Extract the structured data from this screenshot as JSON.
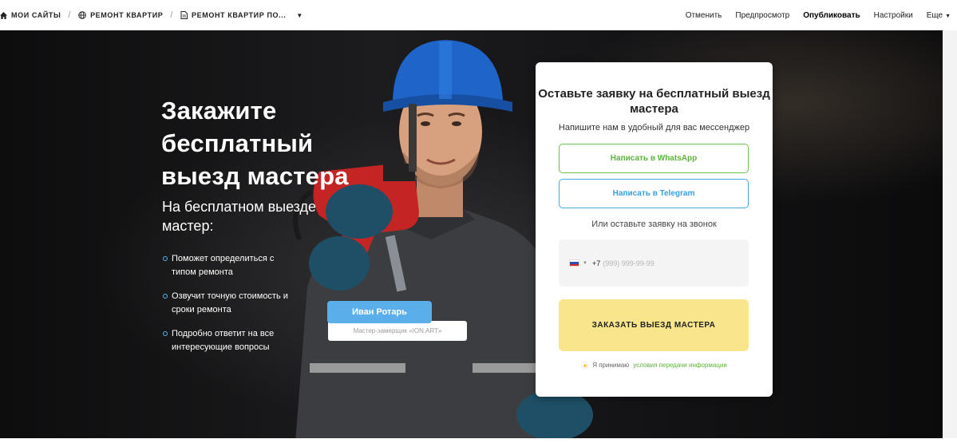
{
  "topbar": {
    "breadcrumbs": [
      {
        "label": "МОИ САЙТЫ",
        "icon": "home-icon"
      },
      {
        "label": "РЕМОНТ КВАРТИР",
        "icon": "globe-icon"
      },
      {
        "label": "РЕМОНТ КВАРТИР ПО...",
        "icon": "page-icon"
      }
    ],
    "actions": {
      "cancel": "Отменить",
      "preview": "Предпросмотр",
      "publish": "Опубликовать",
      "settings": "Настройки",
      "more": "Еще"
    }
  },
  "hero": {
    "title": "Закажите бесплатный выезд мастера",
    "subtitle": "На бесплатном выезде мастер:",
    "bullets": [
      "Поможет определиться с типом ремонта",
      "Озвучит точную стоимость и сроки ремонта",
      "Подробно ответит на все интересующие вопросы"
    ],
    "badge": {
      "name": "Иван Ротарь",
      "role": "Мастер-замерщик «ION.ART»"
    }
  },
  "form": {
    "title": "Оставьте заявку на бесплатный выезд мастера",
    "subtitle": "Напишите нам в удобный для вас мессенджер",
    "whatsapp_label": "Написать в WhatsApp",
    "telegram_label": "Написать в Telegram",
    "or_text": "Или оставьте заявку на звонок",
    "phone": {
      "code": "+7",
      "placeholder": "(999) 999-99-99",
      "country_icon": "russia-flag-icon"
    },
    "submit_label": "ЗАКАЗАТЬ ВЫЕЗД МАСТЕРА",
    "consent_text": "Я принимаю",
    "consent_link": "условия передачи информации"
  },
  "colors": {
    "whatsapp": "#5bb33a",
    "telegram": "#3a9fdb",
    "submit_bg": "#f9e58b",
    "badge_bg": "#5aaee9",
    "bullet_dot": "#5bb6f0"
  }
}
